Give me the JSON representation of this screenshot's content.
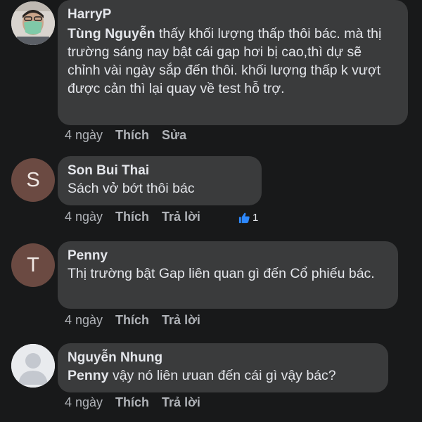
{
  "comments": [
    {
      "author": "HarryP",
      "mention": "Tùng Nguyễn",
      "text": "thấy khối lượng thấp thôi bác. mà thị trường sáng nay bật cái gap hơi bị cao,thì dự sẽ chỉnh vài ngày sắp đến thôi. khối lượng thấp k vượt được cản thì lại quay về test hỗ trợ.",
      "time": "4 ngày",
      "like_label": "Thích",
      "second_action": "Sửa"
    },
    {
      "avatar_letter": "S",
      "author": "Son Bui Thai",
      "text": "Sách vở bớt thôi bác",
      "time": "4 ngày",
      "like_label": "Thích",
      "second_action": "Trả lời",
      "reaction_count": "1"
    },
    {
      "avatar_letter": "T",
      "author": "Penny",
      "text": "Thị trường bật Gap liên quan gì đến Cổ phiếu bác.",
      "time": "4 ngày",
      "like_label": "Thích",
      "second_action": "Trả lời"
    },
    {
      "author": "Nguyễn Nhung",
      "mention": "Penny",
      "text": "vậy nó liên ưuan đến cái gì vậy bác?",
      "time": "4 ngày",
      "like_label": "Thích",
      "second_action": "Trả lời"
    }
  ],
  "colors": {
    "background": "#18191a",
    "bubble": "#3a3b3c",
    "text": "#e4e6eb",
    "secondary_text": "#b0b3b8",
    "like_blue": "#2d88ff"
  },
  "icons": {
    "like": "thumbs-up-icon",
    "blank_avatar": "default-person-avatar"
  }
}
